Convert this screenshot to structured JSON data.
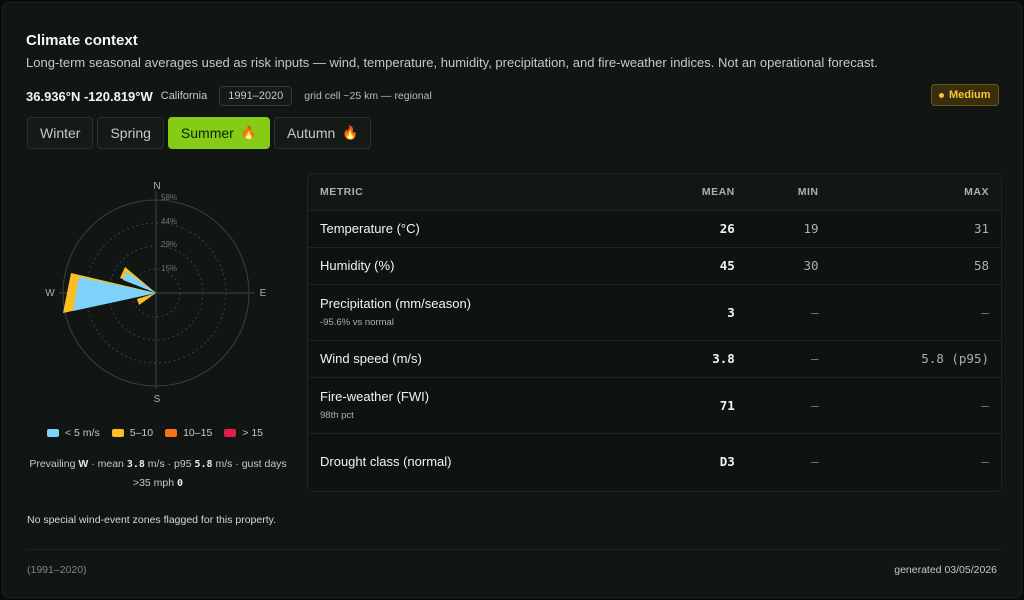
{
  "header": {
    "title": "Climate context",
    "subtitle": "Long-term seasonal averages used as risk inputs — wind, temperature, humidity, precipitation, and fire-weather indices. Not an operational forecast."
  },
  "location": {
    "coords": "36.936°N -120.819°W",
    "state": "California",
    "period": "1991–2020",
    "grid": "grid cell ~25 km — regional"
  },
  "risk": {
    "label": "Medium",
    "color": "#f4c53c"
  },
  "tabs": [
    {
      "label": "Winter",
      "active": false,
      "flame": ""
    },
    {
      "label": "Spring",
      "active": false,
      "flame": ""
    },
    {
      "label": "Summer",
      "active": true,
      "flame": "🔥"
    },
    {
      "label": "Autumn",
      "active": false,
      "flame": "🔥"
    }
  ],
  "wind_rose": {
    "compass": {
      "n": "N",
      "e": "E",
      "s": "S",
      "w": "W"
    },
    "rings": [
      "15%",
      "29%",
      "44%",
      "58%"
    ],
    "legend": [
      {
        "label": "< 5 m/s",
        "color": "#7dd3fc"
      },
      {
        "label": "5–10",
        "color": "#fbbf24"
      },
      {
        "label": "10–15",
        "color": "#f97316"
      },
      {
        "label": "> 15",
        "color": "#e11d48"
      }
    ],
    "summary": {
      "prevailing_label": "Prevailing",
      "prevailing_dir": "W",
      "mean_label": "· mean",
      "mean_value": "3.8",
      "p95_label": "m/s · p95",
      "p95_value": "5.8",
      "gust_label": "m/s · gust days >35 mph",
      "gust_value": "0"
    }
  },
  "table": {
    "headers": {
      "metric": "METRIC",
      "mean": "MEAN",
      "min": "MIN",
      "max": "MAX"
    },
    "rows": [
      {
        "metric": "Temperature (°C)",
        "sub": "",
        "mean": "26",
        "min": "19",
        "max": "31"
      },
      {
        "metric": "Humidity (%)",
        "sub": "",
        "mean": "45",
        "min": "30",
        "max": "58"
      },
      {
        "metric": "Precipitation (mm/season)",
        "sub": "-95.6% vs normal",
        "mean": "3",
        "min": "—",
        "max": "—"
      },
      {
        "metric": "Wind speed (m/s)",
        "sub": "",
        "mean": "3.8",
        "min": "—",
        "max": "5.8 (p95)"
      },
      {
        "metric": "Fire-weather (FWI)",
        "sub": "98th pct",
        "mean": "71",
        "min": "—",
        "max": "—"
      },
      {
        "metric": "Drought class (normal)",
        "sub": "",
        "mean": "D3",
        "min": "—",
        "max": "—"
      }
    ]
  },
  "wind_note": "No special wind-event zones flagged for this property.",
  "footer": {
    "left": "(1991–2020)",
    "right": "generated 03/05/2026"
  }
}
